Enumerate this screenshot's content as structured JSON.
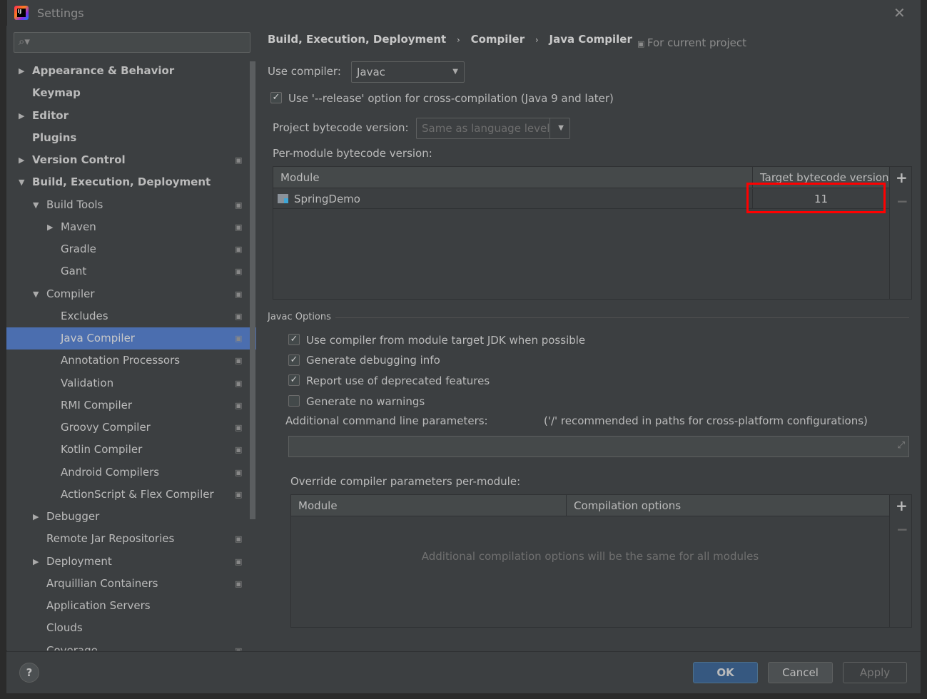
{
  "window": {
    "title": "Settings",
    "close_icon": "close-icon"
  },
  "search": {
    "placeholder": ""
  },
  "sidebar": {
    "items": [
      {
        "label": "Appearance & Behavior",
        "level": 0,
        "arrow": "▶",
        "bold": true
      },
      {
        "label": "Keymap",
        "level": 0,
        "arrow": "",
        "bold": true
      },
      {
        "label": "Editor",
        "level": 0,
        "arrow": "▶",
        "bold": true
      },
      {
        "label": "Plugins",
        "level": 0,
        "arrow": "",
        "bold": true
      },
      {
        "label": "Version Control",
        "level": 0,
        "arrow": "▶",
        "bold": true,
        "proj": true
      },
      {
        "label": "Build, Execution, Deployment",
        "level": 0,
        "arrow": "▼",
        "bold": true
      },
      {
        "label": "Build Tools",
        "level": 1,
        "arrow": "▼",
        "proj": true
      },
      {
        "label": "Maven",
        "level": 2,
        "arrow": "▶",
        "proj": true
      },
      {
        "label": "Gradle",
        "level": 2,
        "arrow": "",
        "proj": true
      },
      {
        "label": "Gant",
        "level": 2,
        "arrow": "",
        "proj": true
      },
      {
        "label": "Compiler",
        "level": 1,
        "arrow": "▼",
        "proj": true
      },
      {
        "label": "Excludes",
        "level": 2,
        "arrow": "",
        "proj": true
      },
      {
        "label": "Java Compiler",
        "level": 2,
        "arrow": "",
        "proj": true,
        "selected": true
      },
      {
        "label": "Annotation Processors",
        "level": 2,
        "arrow": "",
        "proj": true
      },
      {
        "label": "Validation",
        "level": 2,
        "arrow": "",
        "proj": true
      },
      {
        "label": "RMI Compiler",
        "level": 2,
        "arrow": "",
        "proj": true
      },
      {
        "label": "Groovy Compiler",
        "level": 2,
        "arrow": "",
        "proj": true
      },
      {
        "label": "Kotlin Compiler",
        "level": 2,
        "arrow": "",
        "proj": true
      },
      {
        "label": "Android Compilers",
        "level": 2,
        "arrow": "",
        "proj": true
      },
      {
        "label": "ActionScript & Flex Compiler",
        "level": 2,
        "arrow": "",
        "proj": true
      },
      {
        "label": "Debugger",
        "level": 1,
        "arrow": "▶"
      },
      {
        "label": "Remote Jar Repositories",
        "level": 1,
        "arrow": "",
        "proj": true
      },
      {
        "label": "Deployment",
        "level": 1,
        "arrow": "▶",
        "proj": true
      },
      {
        "label": "Arquillian Containers",
        "level": 1,
        "arrow": "",
        "proj": true
      },
      {
        "label": "Application Servers",
        "level": 1,
        "arrow": ""
      },
      {
        "label": "Clouds",
        "level": 1,
        "arrow": ""
      },
      {
        "label": "Coverage",
        "level": 1,
        "arrow": "",
        "proj": true
      }
    ]
  },
  "breadcrumb": [
    "Build, Execution, Deployment",
    "Compiler",
    "Java Compiler"
  ],
  "for_current_project": "For current project",
  "use_compiler": {
    "label": "Use compiler:",
    "value": "Javac"
  },
  "release_option": {
    "label": "Use '--release' option for cross-compilation (Java 9 and later)",
    "checked": true
  },
  "project_bytecode": {
    "label": "Project bytecode version:",
    "value": "Same as language level"
  },
  "per_module": {
    "label": "Per-module bytecode version:",
    "columns": [
      "Module",
      "Target bytecode version"
    ],
    "rows": [
      {
        "module": "SpringDemo",
        "version": "11"
      }
    ]
  },
  "javac": {
    "title": "Javac Options",
    "options": [
      {
        "label": "Use compiler from module target JDK when possible",
        "checked": true
      },
      {
        "label": "Generate debugging info",
        "checked": true
      },
      {
        "label": "Report use of deprecated features",
        "checked": true
      },
      {
        "label": "Generate no warnings",
        "checked": false
      }
    ],
    "additional_label": "Additional command line parameters:",
    "additional_hint": "('/' recommended in paths for cross-platform configurations)",
    "additional_value": ""
  },
  "override": {
    "label": "Override compiler parameters per-module:",
    "columns": [
      "Module",
      "Compilation options"
    ],
    "empty_text": "Additional compilation options will be the same for all modules"
  },
  "buttons": {
    "ok": "OK",
    "cancel": "Cancel",
    "apply": "Apply",
    "help": "?"
  },
  "colors": {
    "accent": "#4b6eaf",
    "highlight": "#ff0000",
    "background": "#3c3f41"
  }
}
